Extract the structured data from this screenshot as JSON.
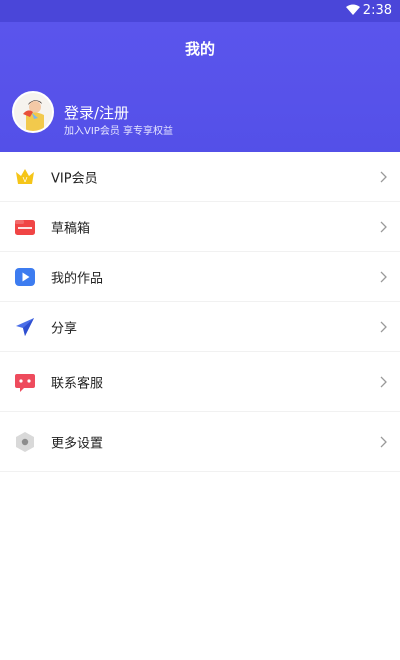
{
  "status_bar": {
    "time": "2:38"
  },
  "header": {
    "title": "我的",
    "login_title": "登录/注册",
    "login_subtitle": "加入VIP会员 享专享权益"
  },
  "menu": {
    "items": [
      {
        "label": "VIP会员",
        "icon": "vip-crown-icon"
      },
      {
        "label": "草稿箱",
        "icon": "drafts-folder-icon"
      },
      {
        "label": "我的作品",
        "icon": "video-play-icon"
      },
      {
        "label": "分享",
        "icon": "paper-plane-icon"
      },
      {
        "label": "联系客服",
        "icon": "chat-support-icon"
      },
      {
        "label": "更多设置",
        "icon": "settings-hexagon-icon"
      }
    ]
  },
  "colors": {
    "header_bg": "#5752ea",
    "status_bg": "#4a46d9"
  }
}
